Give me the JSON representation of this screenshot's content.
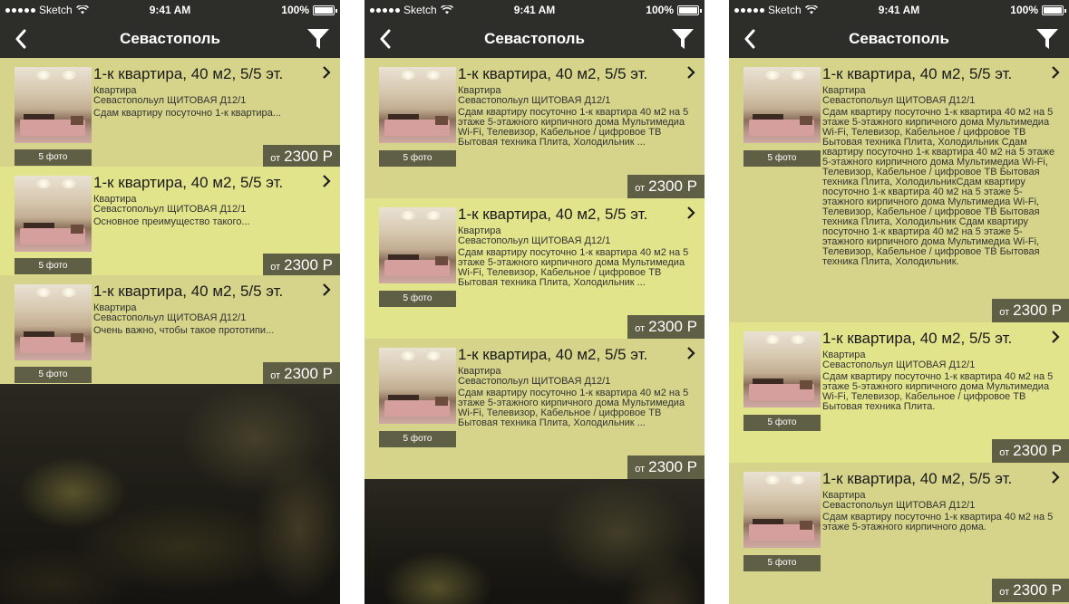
{
  "screens": [
    {
      "status": {
        "carrier": "Sketch",
        "time": "9:41 AM",
        "battery": "100%"
      },
      "nav": {
        "title": "Севастополь",
        "back_icon": "chevron-left-icon",
        "filter_icon": "filter-icon"
      },
      "cards": [
        {
          "title": "1-к квартира, 40 м2, 5/5 эт.",
          "type": "Квартира",
          "address": "Севастопольул ЩИТОВАЯ Д12/1",
          "description": "Сдам квартиру посуточно 1-к квартира...",
          "photos": "5 фото",
          "price_from": "от",
          "price": "2300 Р"
        },
        {
          "title": "1-к квартира, 40 м2, 5/5 эт.",
          "type": "Квартира",
          "address": "Севастопольул ЩИТОВАЯ Д12/1",
          "description": "Основное преимущество такого...",
          "photos": "5 фото",
          "price_from": "от",
          "price": "2300 Р"
        },
        {
          "title": "1-к квартира, 40 м2, 5/5 эт.",
          "type": "Квартира",
          "address": "Севастопольул ЩИТОВАЯ Д12/1",
          "description": "Очень важно, чтобы такое прототипи...",
          "photos": "5 фото",
          "price_from": "от",
          "price": "2300 Р"
        }
      ]
    },
    {
      "status": {
        "carrier": "Sketch",
        "time": "9:41 AM",
        "battery": "100%"
      },
      "nav": {
        "title": "Севастополь",
        "back_icon": "chevron-left-icon",
        "filter_icon": "filter-icon"
      },
      "cards": [
        {
          "title": "1-к квартира, 40 м2, 5/5 эт.",
          "type": "Квартира",
          "address": "Севастопольул ЩИТОВАЯ Д12/1",
          "description": "Сдам квартиру посуточно 1-к квартира 40 м2 на 5 этаже 5-этажного кирпичного дома Мультимедиа Wi-Fi, Телевизор, Кабельное / цифровое ТВ Бытовая техника Плита, Холодильник ...",
          "photos": "5 фото",
          "price_from": "от",
          "price": "2300 Р"
        },
        {
          "title": "1-к квартира, 40 м2, 5/5 эт.",
          "type": "Квартира",
          "address": "Севастопольул ЩИТОВАЯ Д12/1",
          "description": "Сдам квартиру посуточно 1-к квартира 40 м2 на 5 этаже 5-этажного кирпичного дома Мультимедиа Wi-Fi, Телевизор, Кабельное / цифровое ТВ Бытовая техника Плита, Холодильник ...",
          "photos": "5 фото",
          "price_from": "от",
          "price": "2300 Р"
        },
        {
          "title": "1-к квартира, 40 м2, 5/5 эт.",
          "type": "Квартира",
          "address": "Севастопольул ЩИТОВАЯ Д12/1",
          "description": "Сдам квартиру посуточно 1-к квартира 40 м2 на 5 этаже 5-этажного кирпичного дома Мультимедиа Wi-Fi, Телевизор, Кабельное / цифровое ТВ Бытовая техника Плита, Холодильник ...",
          "photos": "5 фото",
          "price_from": "от",
          "price": "2300 Р"
        }
      ]
    },
    {
      "status": {
        "carrier": "Sketch",
        "time": "9:41 AM",
        "battery": "100%"
      },
      "nav": {
        "title": "Севастополь",
        "back_icon": "chevron-left-icon",
        "filter_icon": "filter-icon"
      },
      "cards": [
        {
          "title": "1-к квартира, 40 м2, 5/5 эт.",
          "type": "Квартира",
          "address": "Севастопольул ЩИТОВАЯ Д12/1",
          "description": "Сдам квартиру посуточно 1-к квартира 40 м2 на 5 этаже 5-этажного кирпичного дома Мультимедиа Wi-Fi, Телевизор, Кабельное / цифровое ТВ Бытовая техника Плита, Холодильник Сдам квартиру посуточно 1-к квартира 40 м2 на 5 этаже 5-этажного кирпичного дома Мультимедиа Wi-Fi, Телевизор, Кабельное / цифровое ТВ Бытовая техника Плита, ХолодильникСдам квартиру посуточно 1-к квартира 40 м2 на 5 этаже 5-этажного кирпичного дома Мультимедиа Wi-Fi, Телевизор, Кабельное / цифровое ТВ Бытовая техника Плита, Холодильник Сдам квартиру посуточно 1-к квартира 40 м2 на 5 этаже 5-этажного кирпичного дома Мультимедиа Wi-Fi, Телевизор, Кабельное / цифровое ТВ Бытовая техника Плита, Холодильник.",
          "photos": "5 фото",
          "price_from": "от",
          "price": "2300 Р"
        },
        {
          "title": "1-к квартира, 40 м2, 5/5 эт.",
          "type": "Квартира",
          "address": "Севастопольул ЩИТОВАЯ Д12/1",
          "description": "Сдам квартиру посуточно 1-к квартира 40 м2 на 5 этаже 5-этажного кирпичного дома Мультимедиа Wi-Fi, Телевизор, Кабельное / цифровое ТВ Бытовая техника Плита.",
          "photos": "5 фото",
          "price_from": "от",
          "price": "2300 Р"
        },
        {
          "title": "1-к квартира, 40 м2, 5/5 эт.",
          "type": "Квартира",
          "address": "Севастопольул ЩИТОВАЯ Д12/1",
          "description": "Сдам квартиру посуточно 1-к квартира 40 м2 на 5 этаже 5-этажного кирпичного дома.",
          "photos": "5 фото",
          "price_from": "от",
          "price": "2300 Р"
        }
      ]
    }
  ]
}
